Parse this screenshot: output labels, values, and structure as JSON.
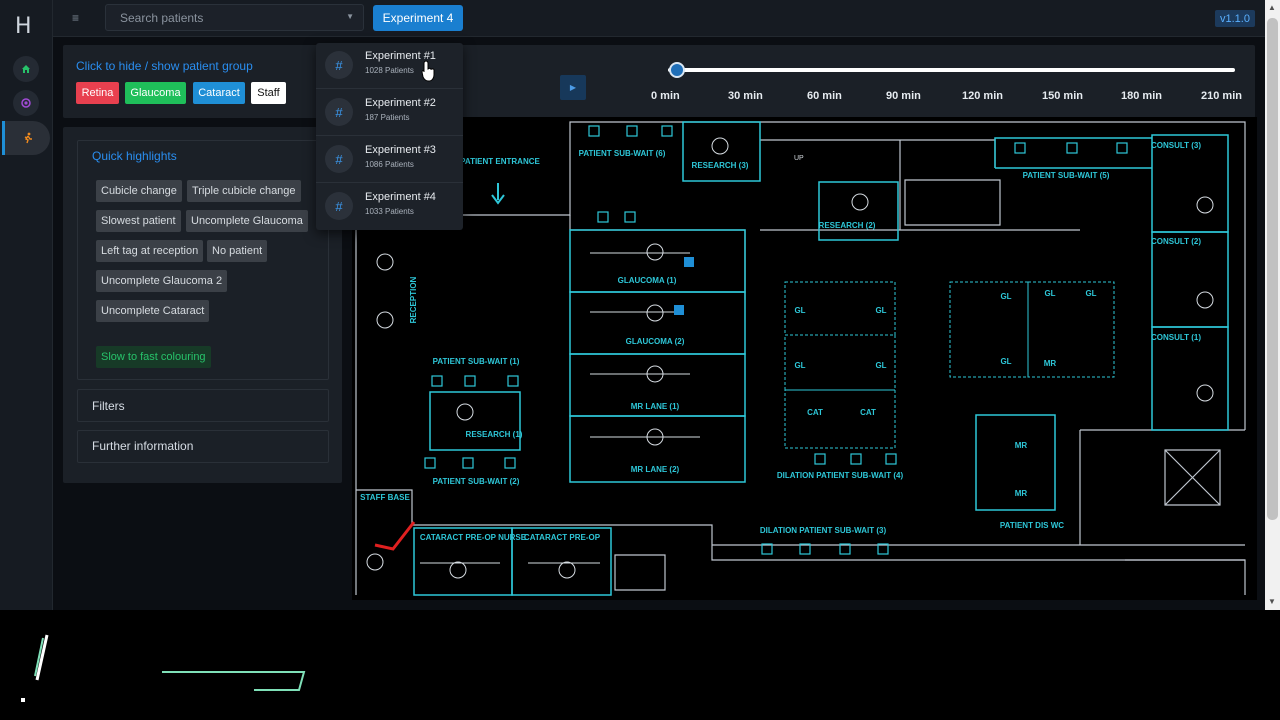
{
  "app": {
    "logo": "H",
    "version": "v1.1.0"
  },
  "topbar": {
    "search_placeholder": "Search patients",
    "experiment_button": "Experiment 4"
  },
  "patient_group": {
    "toggle_label": "Click to hide / show patient group",
    "chips": [
      {
        "label": "Retina",
        "color": "#e8404f"
      },
      {
        "label": "Glaucoma",
        "color": "#1fbf5a"
      },
      {
        "label": "Cataract",
        "color": "#1f8fd6"
      },
      {
        "label": "Staff",
        "color": "#ffffff"
      }
    ]
  },
  "timeline": {
    "ticks": [
      "0 min",
      "30 min",
      "60 min",
      "90 min",
      "120 min",
      "150 min",
      "180 min",
      "210 min"
    ],
    "position_fraction": 0.0
  },
  "highlights": {
    "title": "Quick highlights",
    "items": [
      "Cubicle change",
      "Triple cubicle change",
      "Slowest patient",
      "Uncomplete Glaucoma",
      "Left tag at reception",
      "No patient",
      "Uncomplete Glaucoma 2",
      "Uncomplete Cataract"
    ],
    "colouring": "Slow to fast colouring"
  },
  "sections": {
    "filters": "Filters",
    "further": "Further information"
  },
  "experiments": [
    {
      "name": "Experiment #1",
      "patients": "1028 Patients"
    },
    {
      "name": "Experiment #2",
      "patients": "187 Patients"
    },
    {
      "name": "Experiment #3",
      "patients": "1086 Patients"
    },
    {
      "name": "Experiment #4",
      "patients": "1033 Patients"
    }
  ],
  "map_labels": {
    "patient_entrance": "PATIENT ENTRANCE",
    "reception": "RECEPTION",
    "sub_wait_6": "PATIENT SUB-WAIT (6)",
    "research_3": "RESEARCH (3)",
    "research_2": "RESEARCH (2)",
    "sub_wait_5": "PATIENT SUB-WAIT (5)",
    "consult_3": "CONSULT (3)",
    "consult_2": "CONSULT (2)",
    "consult_1": "CONSULT (1)",
    "glaucoma_1": "GLAUCOMA (1)",
    "glaucoma_2": "GLAUCOMA (2)",
    "mr_lane_1": "MR LANE (1)",
    "mr_lane_2": "MR LANE (2)",
    "sub_wait_1": "PATIENT SUB-WAIT (1)",
    "research_1": "RESEARCH (1)",
    "sub_wait_2": "PATIENT SUB-WAIT (2)",
    "gl": "GL",
    "cat": "CAT",
    "mr": "MR",
    "dilation_4": "DILATION PATIENT SUB-WAIT (4)",
    "dilation_3": "DILATION PATIENT SUB-WAIT (3)",
    "staff_base": "STAFF BASE",
    "cataract_preop_nurse": "CATARACT PRE-OP NURSE",
    "cataract_preop": "CATARACT PRE-OP",
    "patient_dis_wc": "PATIENT DIS WC",
    "up": "UP"
  }
}
